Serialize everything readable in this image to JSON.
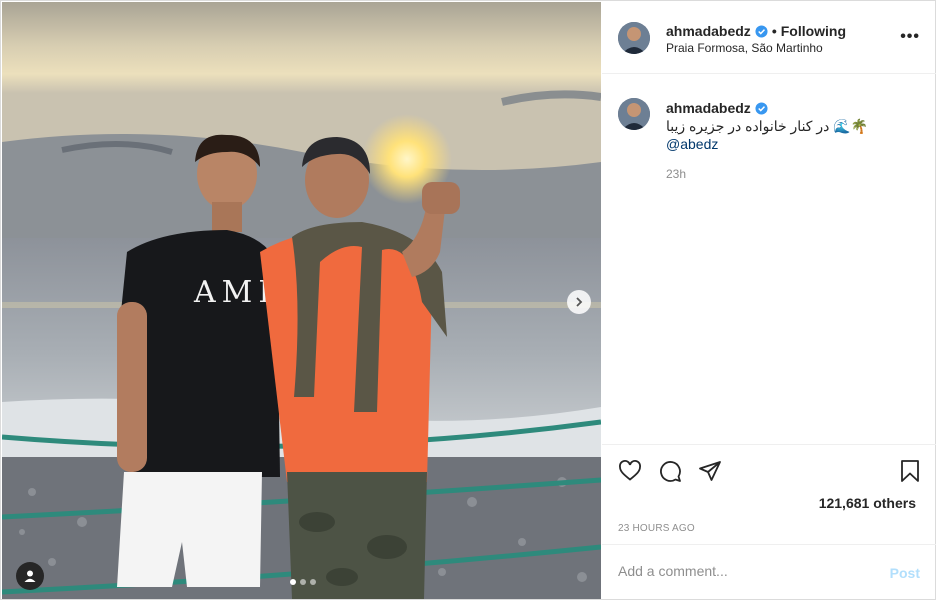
{
  "header": {
    "username": "ahmadabedz",
    "separator": "•",
    "follow_status": "Following",
    "location": "Praia Formosa, São Martinho",
    "more": "•••"
  },
  "caption": {
    "username": "ahmadabedz",
    "text": "در کنار خانواده در جزیره زیبا",
    "emojis": "🌊🌴",
    "mention": "@abedz",
    "time": "23h"
  },
  "photo": {
    "shirt_print": "AMIRI"
  },
  "actions": {
    "likes": "121,681 others",
    "time_ago": "23 HOURS AGO"
  },
  "comment": {
    "placeholder": "Add a comment...",
    "post_label": "Post"
  },
  "colors": {
    "verified": "#3897f0",
    "link": "#00376b",
    "post_disabled": "#b2dffc",
    "muted": "#8e8e8e"
  },
  "icons": {
    "like": "heart-icon",
    "comment": "comment-icon",
    "share": "paper-plane-icon",
    "save": "bookmark-icon",
    "next": "chevron-right-icon",
    "tag": "user-tag-icon"
  }
}
